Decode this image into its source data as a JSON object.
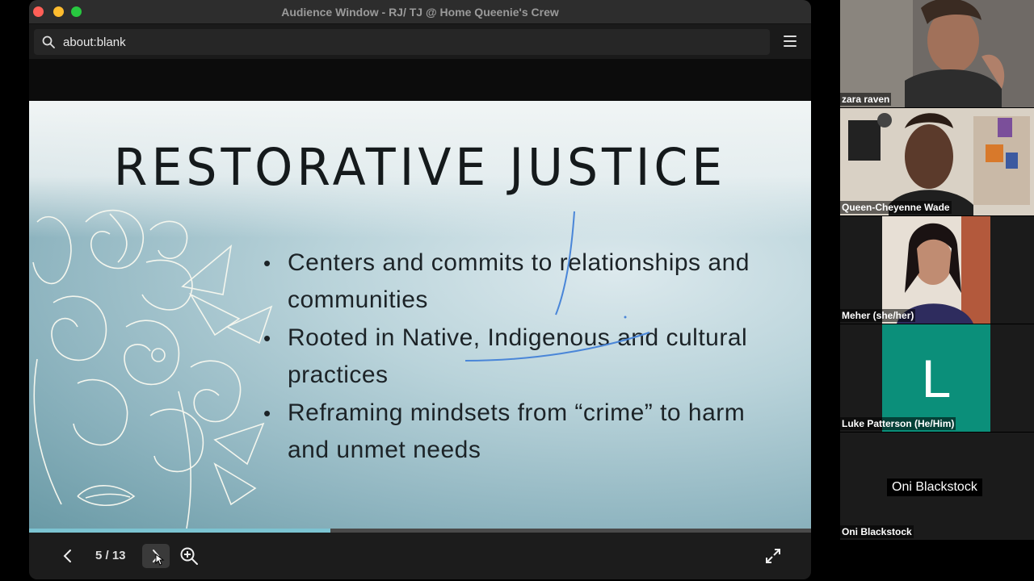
{
  "window": {
    "title": "Audience Window - RJ/ TJ @ Home Queenie's Crew",
    "url": "about:blank"
  },
  "slide": {
    "title": "RESTORATIVE JUSTICE",
    "bullets": [
      "Centers and commits to relationships and communities",
      "Rooted in Native, Indigenous and cultural practices",
      "Reframing mindsets from “crime” to harm and unmet needs"
    ],
    "progress_fraction": 0.385
  },
  "controls": {
    "page_indicator": "5 / 13",
    "icons": [
      "chevron-left-icon",
      "chevron-right-icon",
      "zoom-in-icon",
      "fullscreen-icon"
    ]
  },
  "participants": [
    {
      "name": "zara raven",
      "type": "video"
    },
    {
      "name": "Queen-Cheyenne Wade",
      "type": "video"
    },
    {
      "name": "Meher (she/her)",
      "type": "video"
    },
    {
      "name": "Luke Patterson (He/Him)",
      "type": "avatar",
      "initial": "L",
      "color": "#0b8f7a"
    },
    {
      "name": "Oni Blackstock",
      "type": "name-only",
      "display_name": "Oni Blackstock"
    }
  ]
}
